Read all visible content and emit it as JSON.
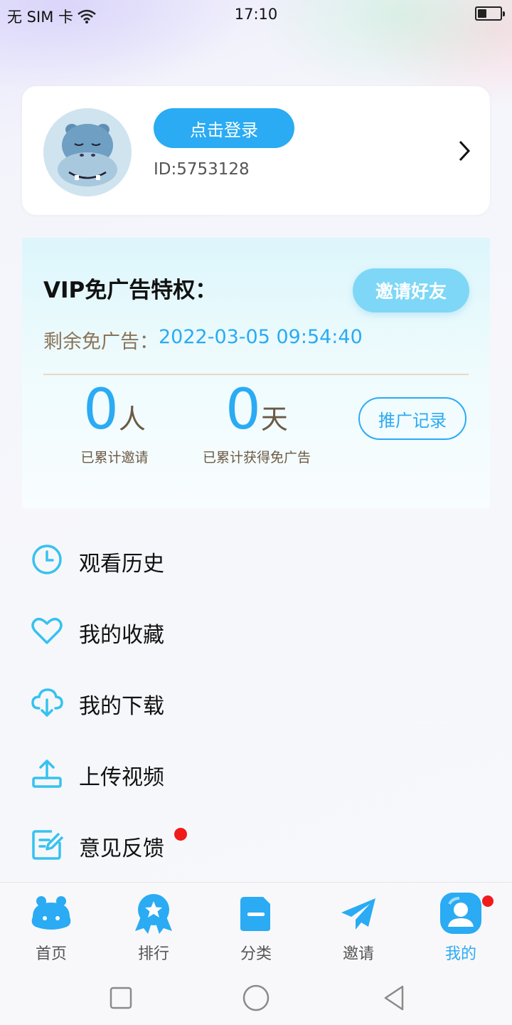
{
  "status_bar": {
    "carrier": "无 SIM 卡",
    "time": "17:10",
    "battery_percent": 40
  },
  "profile": {
    "login_button": "点击登录",
    "user_id": "ID:5753128",
    "avatar_icon": "hippo-avatar-icon",
    "chevron_icon": "chevron-right-icon"
  },
  "vip": {
    "title": "VIP免广告特权：",
    "invite_button": "邀请好友",
    "remaining_label": "剩余免广告：",
    "remaining_value": "2022-03-05 09:54:40",
    "invited_count": "0",
    "invited_unit": "人",
    "invited_label": "已累计邀请",
    "days_count": "0",
    "days_unit": "天",
    "days_label": "已累计获得免广告",
    "record_button": "推广记录"
  },
  "menu": {
    "items": [
      {
        "label": "观看历史",
        "icon": "clock-icon"
      },
      {
        "label": "我的收藏",
        "icon": "heart-icon"
      },
      {
        "label": "我的下载",
        "icon": "cloud-download-icon"
      },
      {
        "label": "上传视频",
        "icon": "upload-icon"
      },
      {
        "label": "意见反馈",
        "icon": "feedback-edit-icon",
        "badge": "red-dot"
      }
    ]
  },
  "tabbar": {
    "tabs": [
      {
        "label": "首页",
        "icon": "hippo-home-icon"
      },
      {
        "label": "排行",
        "icon": "ranking-badge-icon"
      },
      {
        "label": "分类",
        "icon": "category-folder-icon"
      },
      {
        "label": "邀请",
        "icon": "paper-plane-icon"
      },
      {
        "label": "我的",
        "icon": "profile-icon",
        "active": true,
        "badge": "red-dot"
      }
    ]
  },
  "colors": {
    "accent": "#2aabf3",
    "invite_button": "#7ed7f6",
    "brown_text": "#8a7458",
    "badge_red": "#f01c1c"
  }
}
